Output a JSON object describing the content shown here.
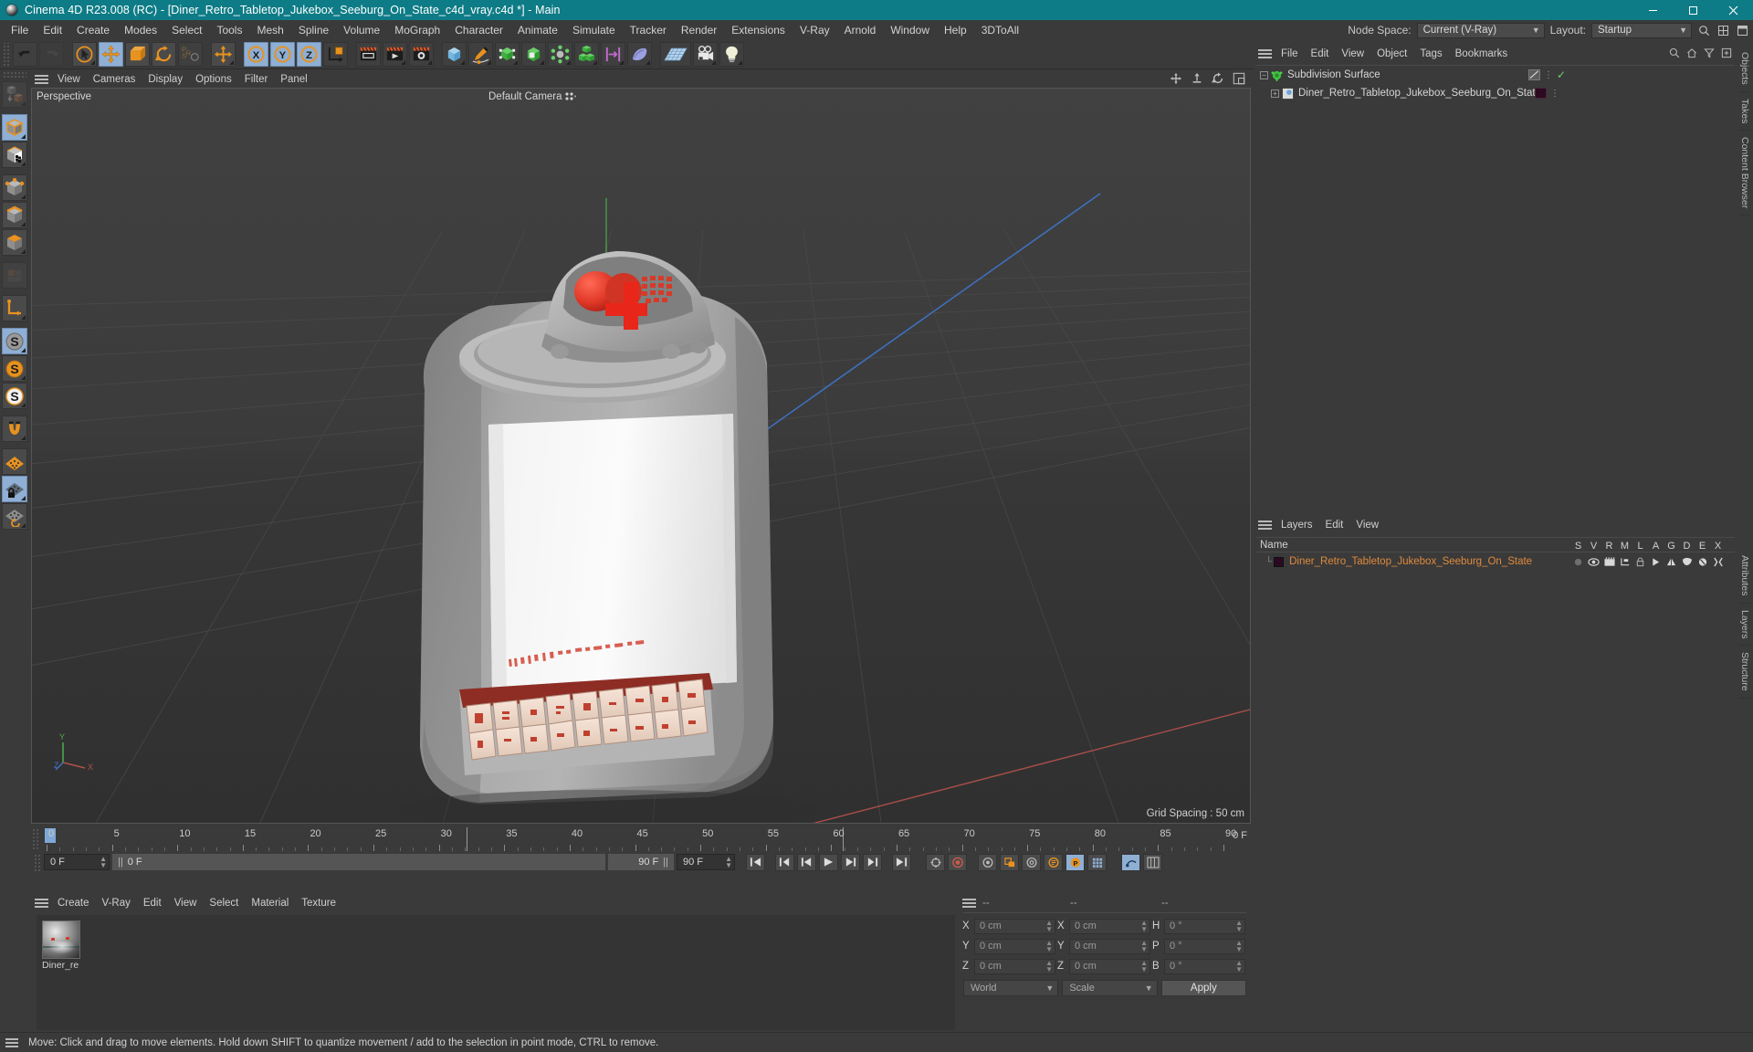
{
  "window": {
    "title": "Cinema 4D R23.008 (RC) - [Diner_Retro_Tabletop_Jukebox_Seeburg_On_State_c4d_vray.c4d *] - Main",
    "minimize": "minimize-icon",
    "maximize": "maximize-icon",
    "close": "close-icon"
  },
  "menubar": {
    "items": [
      "File",
      "Edit",
      "Create",
      "Modes",
      "Select",
      "Tools",
      "Mesh",
      "Spline",
      "Volume",
      "MoGraph",
      "Character",
      "Animate",
      "Simulate",
      "Tracker",
      "Render",
      "Extensions",
      "V-Ray",
      "Arnold",
      "Window",
      "Help",
      "3DToAll"
    ],
    "node_space_label": "Node Space:",
    "node_space_value": "Current (V-Ray)",
    "layout_label": "Layout:",
    "layout_value": "Startup",
    "search_icon": "search-icon",
    "grid_icon": "grid-icon",
    "panel_icon": "panel-icon"
  },
  "toolbar": {
    "buttons": [
      {
        "name": "undo-button",
        "icon": "undo-icon",
        "state": "normal"
      },
      {
        "name": "redo-button",
        "icon": "redo-icon",
        "state": "disabled"
      },
      {
        "name": "live-selection-button",
        "icon": "cursor-circle-icon",
        "state": "normal"
      },
      {
        "name": "move-tool-button",
        "icon": "move-arrows-icon",
        "state": "active"
      },
      {
        "name": "scale-tool-button",
        "icon": "scale-box-icon",
        "state": "normal"
      },
      {
        "name": "rotate-tool-button",
        "icon": "rotate-icon",
        "state": "normal"
      },
      {
        "name": "psr-button",
        "icon": "psr-icon",
        "state": "normal"
      },
      {
        "name": "move-axis-button",
        "icon": "move-arrows-icon",
        "state": "normal"
      },
      {
        "name": "lock-x-button",
        "icon": "x-axis-icon",
        "state": "active"
      },
      {
        "name": "lock-y-button",
        "icon": "y-axis-icon",
        "state": "active"
      },
      {
        "name": "lock-z-button",
        "icon": "z-axis-icon",
        "state": "active"
      },
      {
        "name": "world-coord-button",
        "icon": "world-axis-icon",
        "state": "normal"
      },
      {
        "name": "render-view-button",
        "icon": "render-clapper-icon",
        "state": "normal"
      },
      {
        "name": "render-region-button",
        "icon": "render-window-icon",
        "state": "normal"
      },
      {
        "name": "render-queue-button",
        "icon": "render-play-icon",
        "state": "normal"
      },
      {
        "name": "render-settings-button",
        "icon": "render-gear-icon",
        "state": "normal"
      },
      {
        "name": "cube-primitive-button",
        "icon": "blue-cube-icon",
        "state": "normal"
      },
      {
        "name": "spline-pen-button",
        "icon": "pen-spline-icon",
        "state": "normal"
      },
      {
        "name": "nurbs-button",
        "icon": "subdivision-icon",
        "state": "normal"
      },
      {
        "name": "array-button",
        "icon": "green-cube-icon",
        "state": "normal"
      },
      {
        "name": "deformer-button",
        "icon": "atom-icon",
        "state": "normal"
      },
      {
        "name": "mograph-button",
        "icon": "cubes-icon",
        "state": "normal"
      },
      {
        "name": "field-button",
        "icon": "field-icon",
        "state": "normal"
      },
      {
        "name": "sculpt-button",
        "icon": "cloth-icon",
        "state": "normal"
      },
      {
        "name": "floor-button",
        "icon": "floor-grid-icon",
        "state": "normal"
      },
      {
        "name": "camera-button",
        "icon": "camera-icon",
        "state": "normal"
      },
      {
        "name": "light-button",
        "icon": "light-bulb-icon",
        "state": "normal"
      }
    ]
  },
  "left_toolbar": {
    "buttons": [
      {
        "name": "make-editable-button",
        "icon": "make-editable-icon",
        "state": "disabled"
      },
      {
        "name": "model-mode-button",
        "icon": "model-cube-icon",
        "state": "active"
      },
      {
        "name": "texture-mode-button",
        "icon": "texture-cube-icon",
        "state": "normal"
      },
      {
        "name": "points-mode-button",
        "icon": "points-cube-icon",
        "state": "normal"
      },
      {
        "name": "edges-mode-button",
        "icon": "edges-cube-icon",
        "state": "normal"
      },
      {
        "name": "polygons-mode-button",
        "icon": "polygon-cube-icon",
        "state": "normal"
      },
      {
        "name": "uv-mode-button",
        "icon": "uv-grid-icon",
        "state": "disabled"
      },
      {
        "name": "axis-mode-button",
        "icon": "axis-l-icon",
        "state": "normal"
      },
      {
        "name": "enable-axis-button",
        "icon": "s-gray-icon",
        "state": "active"
      },
      {
        "name": "object-axis-button",
        "icon": "s-orange-icon",
        "state": "normal"
      },
      {
        "name": "texture-axis-button",
        "icon": "s-white-icon",
        "state": "normal"
      },
      {
        "name": "snap-magnet-button",
        "icon": "magnet-icon",
        "state": "normal"
      },
      {
        "name": "workplane-button",
        "icon": "workplane-icon",
        "state": "normal"
      },
      {
        "name": "lock-workplane-button",
        "icon": "workplane-lock-icon",
        "state": "active"
      },
      {
        "name": "planar-workplane-button",
        "icon": "workplane-rotate-icon",
        "state": "normal"
      }
    ]
  },
  "viewport": {
    "menu": [
      "View",
      "Cameras",
      "Display",
      "Options",
      "Filter",
      "Panel"
    ],
    "label": "Perspective",
    "camera": "Default Camera",
    "grid_spacing": "Grid Spacing : 50 cm",
    "pan_icon": "pan-icon",
    "dolly_icon": "dolly-icon",
    "rotate_icon": "rotate-view-icon",
    "maximize_icon": "maximize-view-icon",
    "axis_x": "X",
    "axis_y": "Y",
    "axis_z": "Z"
  },
  "timeline": {
    "ticks": [
      {
        "label": "0",
        "frame": 0
      },
      {
        "label": "5",
        "frame": 5
      },
      {
        "label": "10",
        "frame": 10
      },
      {
        "label": "15",
        "frame": 15
      },
      {
        "label": "20",
        "frame": 20
      },
      {
        "label": "25",
        "frame": 25
      },
      {
        "label": "30",
        "frame": 30
      },
      {
        "label": "35",
        "frame": 35
      },
      {
        "label": "40",
        "frame": 40
      },
      {
        "label": "45",
        "frame": 45
      },
      {
        "label": "50",
        "frame": 50
      },
      {
        "label": "55",
        "frame": 55
      },
      {
        "label": "60",
        "frame": 60
      },
      {
        "label": "65",
        "frame": 65
      },
      {
        "label": "70",
        "frame": 70
      },
      {
        "label": "75",
        "frame": 75
      },
      {
        "label": "80",
        "frame": 80
      },
      {
        "label": "85",
        "frame": 85
      },
      {
        "label": "90",
        "frame": 90
      }
    ],
    "current_frame_display": "0 F",
    "playhead_frame": 0,
    "min_frame": 0,
    "max_frame": 90,
    "current_frame_field": "0 F",
    "range_start_field": "0 F",
    "range_end_bar": "90 F",
    "range_end_field": "90 F",
    "controls": [
      {
        "name": "go-to-start-button",
        "icon": "skip-start-icon"
      },
      {
        "name": "previous-key-button",
        "icon": "prev-key-icon"
      },
      {
        "name": "previous-frame-button",
        "icon": "step-back-icon"
      },
      {
        "name": "play-button",
        "icon": "play-icon"
      },
      {
        "name": "next-frame-button",
        "icon": "step-forward-icon"
      },
      {
        "name": "next-key-button",
        "icon": "next-key-icon"
      },
      {
        "name": "go-to-end-button",
        "icon": "skip-end-icon"
      },
      {
        "name": "autokey-button",
        "icon": "autokey-icon"
      },
      {
        "name": "record-button",
        "icon": "record-icon"
      },
      {
        "name": "record-position-button",
        "icon": "key-position-icon"
      },
      {
        "name": "record-scale-button",
        "icon": "key-scale-icon"
      },
      {
        "name": "record-rotation-button",
        "icon": "key-rotation-icon"
      },
      {
        "name": "param-button",
        "icon": "key-param-icon"
      },
      {
        "name": "pla-button",
        "icon": "key-pla-icon"
      },
      {
        "name": "keyframe-dots-button",
        "icon": "keyframe-dots-icon"
      },
      {
        "name": "animation-mode-button",
        "icon": "anim-mode-icon"
      },
      {
        "name": "timeline-settings-button",
        "icon": "timeline-settings-icon"
      }
    ]
  },
  "material_manager": {
    "menu": [
      "Create",
      "V-Ray",
      "Edit",
      "View",
      "Select",
      "Material",
      "Texture"
    ],
    "materials": [
      {
        "name": "Diner_re",
        "swatch": "material-preview"
      }
    ]
  },
  "coordinates": {
    "header": [
      "--",
      "--",
      "--"
    ],
    "rows": [
      {
        "pos_label": "X",
        "pos_value": "0 cm",
        "size_label": "X",
        "size_value": "0 cm",
        "rot_label": "H",
        "rot_value": "0 °"
      },
      {
        "pos_label": "Y",
        "pos_value": "0 cm",
        "size_label": "Y",
        "size_value": "0 cm",
        "rot_label": "P",
        "rot_value": "0 °"
      },
      {
        "pos_label": "Z",
        "pos_value": "0 cm",
        "size_label": "Z",
        "size_value": "0 cm",
        "rot_label": "B",
        "rot_value": "0 °"
      }
    ],
    "system": "World",
    "mode": "Scale",
    "apply": "Apply"
  },
  "object_manager": {
    "menu": [
      "File",
      "Edit",
      "View",
      "Object",
      "Tags",
      "Bookmarks"
    ],
    "icons": [
      "search-icon",
      "home-icon",
      "filter-icon",
      "add-icon"
    ],
    "rows": [
      {
        "name": "Subdivision Surface",
        "indent": 0,
        "icon": "subdivision-surface-icon",
        "has_tag": true,
        "enabled": true
      },
      {
        "name": "Diner_Retro_Tabletop_Jukebox_Seeburg_On_State",
        "indent": 1,
        "icon": "polygon-object-icon",
        "has_tag": true,
        "enabled": false
      }
    ]
  },
  "layer_manager": {
    "menu": [
      "Layers",
      "Edit",
      "View"
    ],
    "name_column": "Name",
    "columns": [
      "S",
      "V",
      "R",
      "M",
      "L",
      "A",
      "G",
      "D",
      "E",
      "X"
    ],
    "rows": [
      {
        "name": "Diner_Retro_Tabletop_Jukebox_Seeburg_On_State",
        "color": "#2b0a1f"
      }
    ]
  },
  "edge_tabs": [
    "Objects",
    "Takes",
    "Content Browser",
    "Attributes",
    "Layers",
    "Structure"
  ],
  "statusbar": {
    "message": "Move: Click and drag to move elements. Hold down SHIFT to quantize movement / add to the selection in point mode, CTRL to remove."
  },
  "colors": {
    "title_bar": "#0e7c86",
    "panel_bg": "#3a3a3a",
    "accent_orange": "#e08a3c",
    "active_blue": "#8fafd4"
  }
}
